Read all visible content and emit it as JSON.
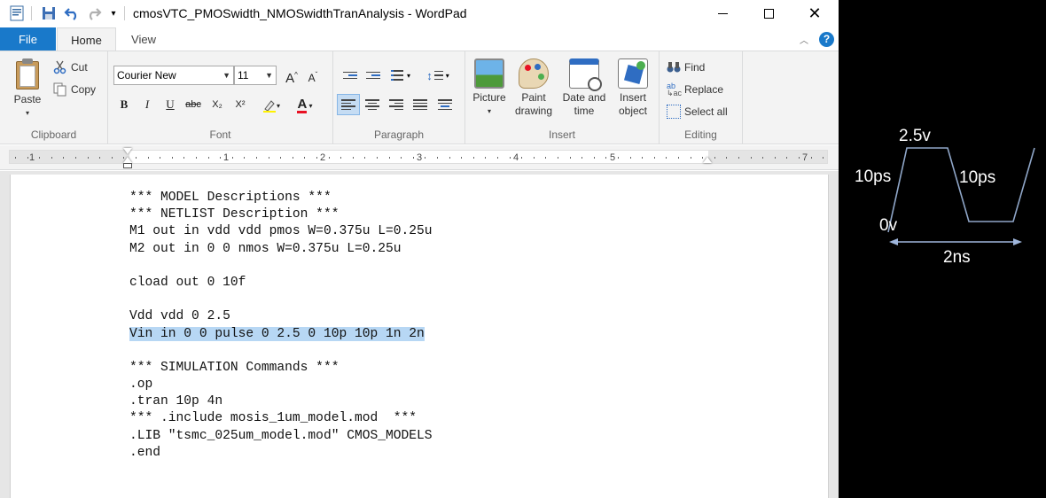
{
  "window": {
    "title": "cmosVTC_PMOSwidth_NMOSwidthTranAnalysis - WordPad",
    "min_icon": "minimize-icon",
    "max_icon": "maximize-icon",
    "close_icon": "close-icon"
  },
  "tabs": {
    "file": "File",
    "home": "Home",
    "view": "View"
  },
  "ribbon": {
    "clipboard": {
      "paste": "Paste",
      "cut": "Cut",
      "copy": "Copy",
      "label": "Clipboard"
    },
    "font": {
      "family": "Courier New",
      "size": "11",
      "label": "Font",
      "bold": "B",
      "italic": "I",
      "underline": "U",
      "strike": "abc",
      "subscript": "X₂",
      "superscript": "X²",
      "grow": "A",
      "shrink": "A"
    },
    "paragraph": {
      "label": "Paragraph"
    },
    "insert": {
      "picture": "Picture",
      "paint1": "Paint",
      "paint2": "drawing",
      "date1": "Date and",
      "date2": "time",
      "object1": "Insert",
      "object2": "object",
      "label": "Insert"
    },
    "editing": {
      "find": "Find",
      "replace": "Replace",
      "select_all": "Select all",
      "label": "Editing"
    }
  },
  "ruler": {
    "marks": [
      "1",
      "1",
      "2",
      "3",
      "4",
      "5",
      "7"
    ]
  },
  "document": {
    "lines": [
      "*** MODEL Descriptions ***",
      "*** NETLIST Description ***",
      "M1 out in vdd vdd pmos W=0.375u L=0.25u",
      "M2 out in 0 0 nmos W=0.375u L=0.25u",
      "",
      "cload out 0 10f",
      "",
      "Vdd vdd 0 2.5",
      "Vin in 0 0 pulse 0 2.5 0 10p 10p 1n 2n",
      "",
      "*** SIMULATION Commands ***",
      ".op",
      ".tran 10p 4n",
      "*** .include mosis_1um_model.mod  ***",
      ".LIB \"tsmc_025um_model.mod\" CMOS_MODELS",
      ".end"
    ],
    "highlighted_line": "Vin in 0 0 pulse 0 2.5 0 10p 10p 1n 2n"
  },
  "diagram": {
    "high": "2.5v",
    "rise": "10ps",
    "fall": "10ps",
    "low": "0v",
    "period": "2ns"
  }
}
